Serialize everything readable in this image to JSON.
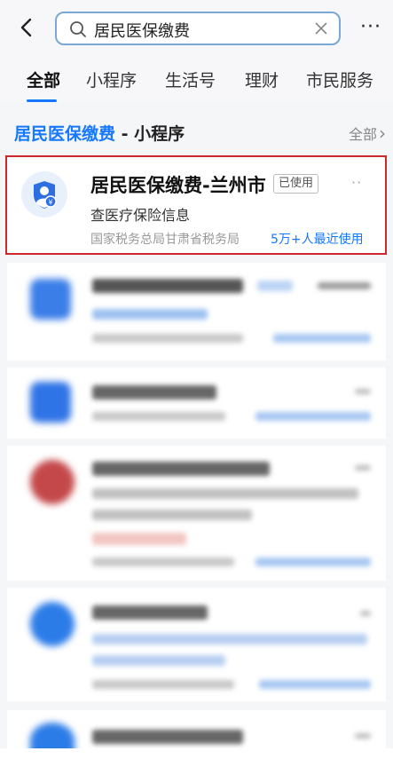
{
  "search": {
    "value": "居民医保缴费"
  },
  "more_label": "···",
  "tabs": [
    {
      "label": "全部",
      "active": true
    },
    {
      "label": "小程序",
      "active": false
    },
    {
      "label": "生活号",
      "active": false
    },
    {
      "label": "理财",
      "active": false
    },
    {
      "label": "市民服务",
      "active": false
    }
  ],
  "section": {
    "title": "居民医保缴费",
    "suffix": " - 小程序",
    "all_link": "全部",
    "chevron": "›"
  },
  "first_result": {
    "title": "居民医保缴费-兰州市",
    "badge": "已使用",
    "more": "··",
    "description": "查医疗保险信息",
    "provider": "国家税务总局甘肃省税务局",
    "usage": "5万+人最近使用"
  },
  "colors": {
    "accent": "#1677ff",
    "highlight_border": "#cc2a2a"
  },
  "icons": {
    "back": "chevron-left-icon",
    "search": "search-icon",
    "clear": "close-icon",
    "app": "shield-person-yuan-icon"
  }
}
